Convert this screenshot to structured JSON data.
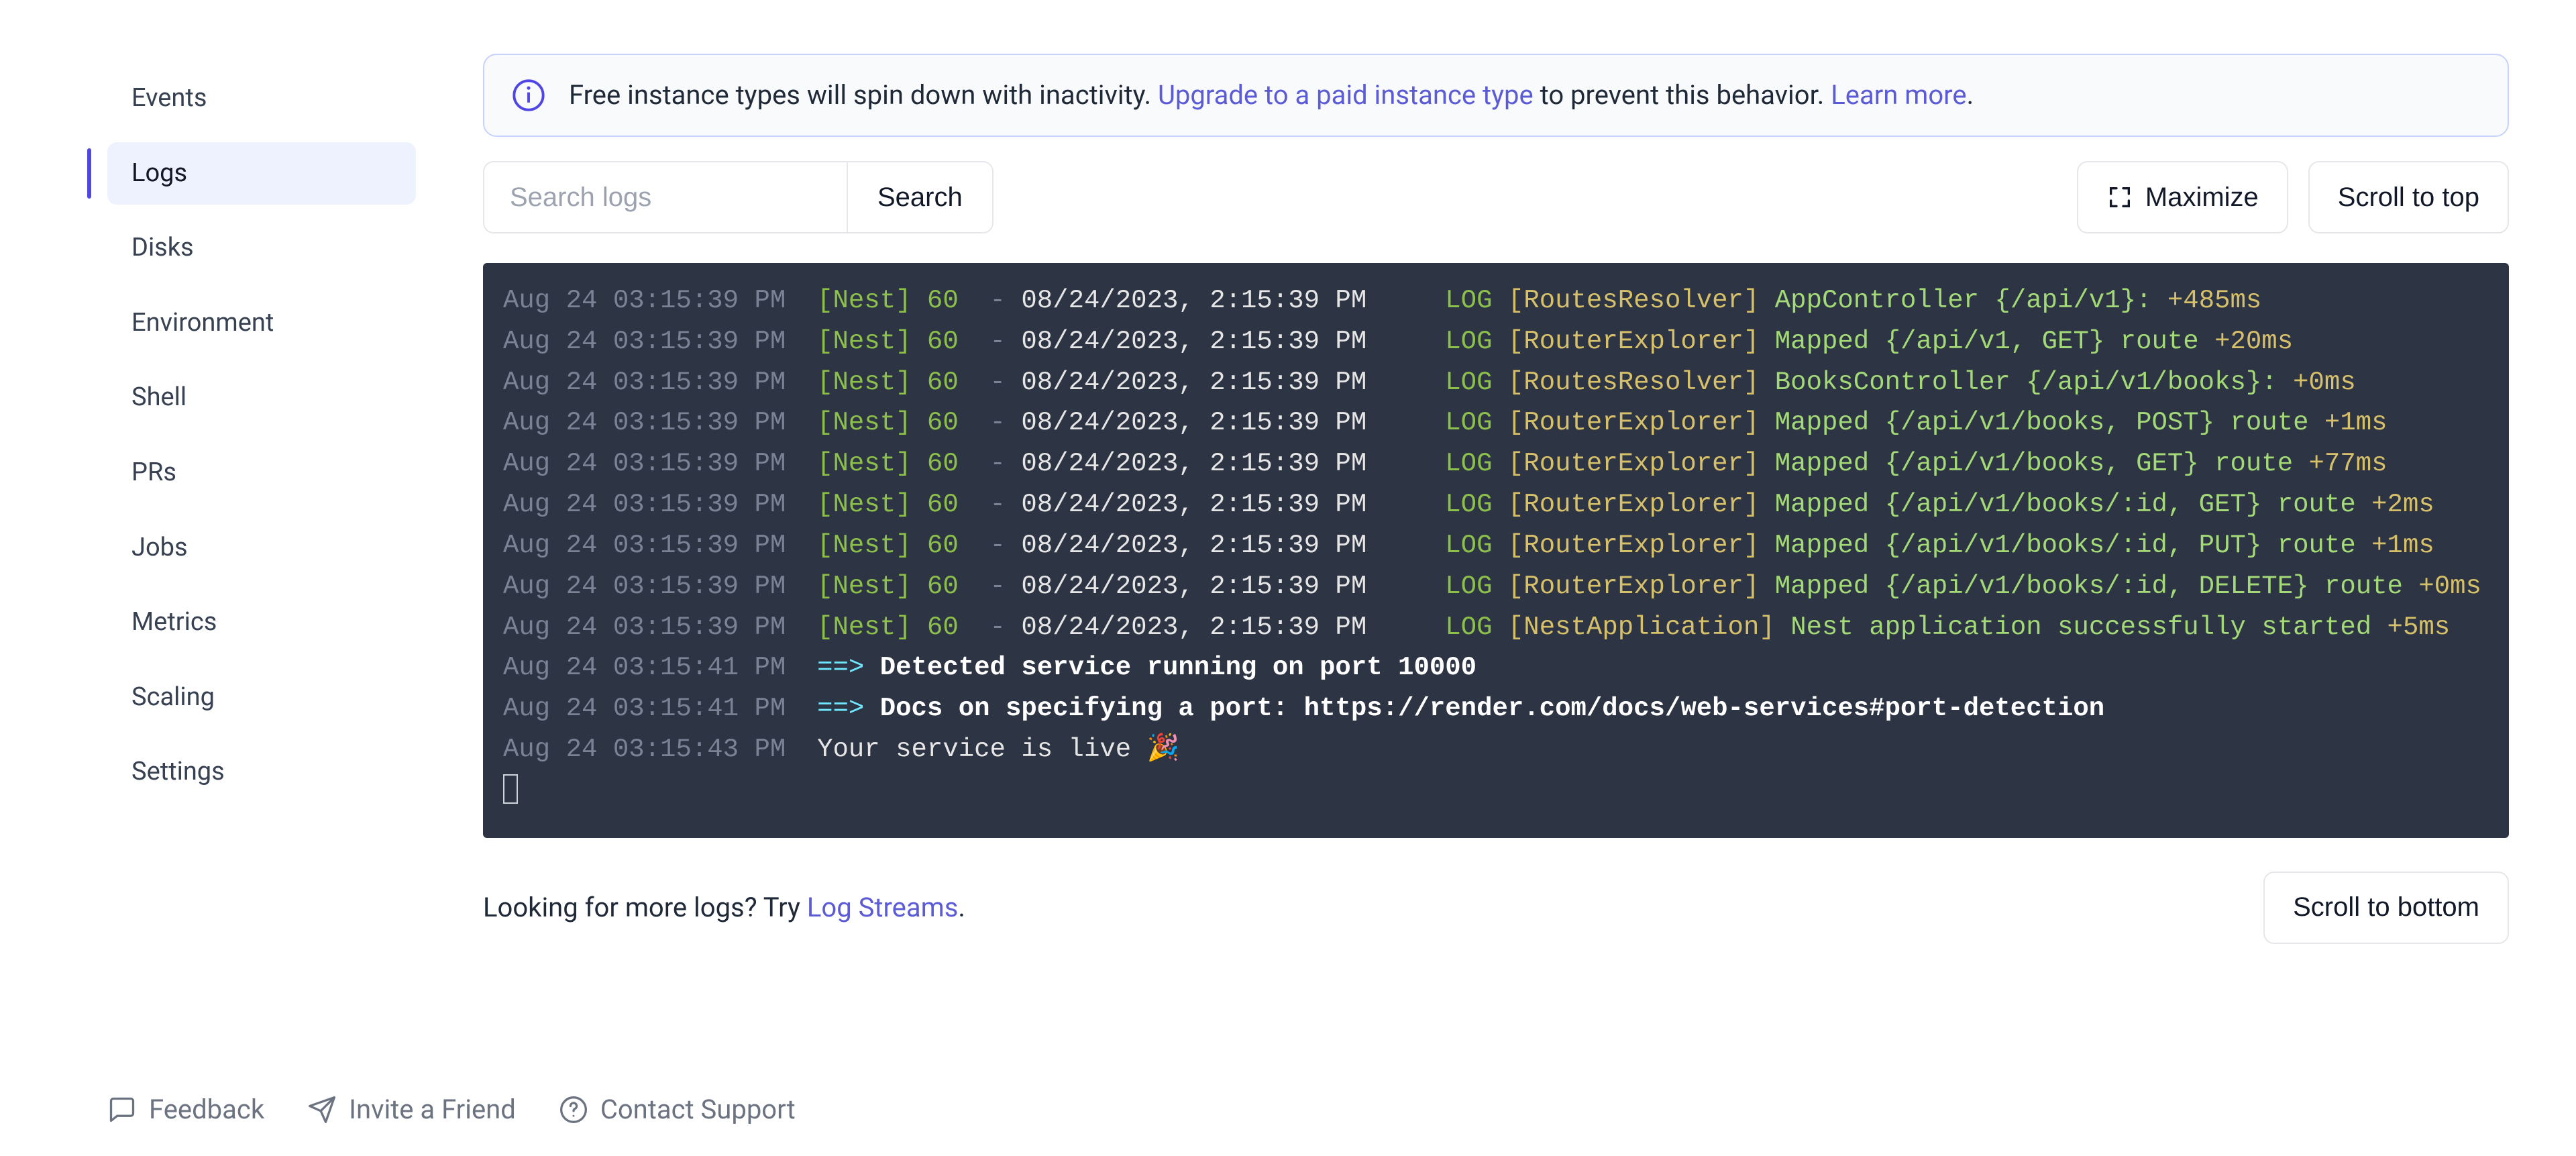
{
  "sidebar": {
    "items": [
      {
        "label": "Events"
      },
      {
        "label": "Logs"
      },
      {
        "label": "Disks"
      },
      {
        "label": "Environment"
      },
      {
        "label": "Shell"
      },
      {
        "label": "PRs"
      },
      {
        "label": "Jobs"
      },
      {
        "label": "Metrics"
      },
      {
        "label": "Scaling"
      },
      {
        "label": "Settings"
      }
    ],
    "activeIndex": 1
  },
  "banner": {
    "text_before": "Free instance types will spin down with inactivity. ",
    "link1": "Upgrade to a paid instance type",
    "text_mid": " to prevent this behavior. ",
    "link2": "Learn more",
    "text_after": "."
  },
  "search": {
    "placeholder": "Search logs",
    "value": "",
    "button": "Search"
  },
  "buttons": {
    "maximize": "Maximize",
    "scroll_top": "Scroll to top",
    "scroll_bottom": "Scroll to bottom"
  },
  "more": {
    "text_before": "Looking for more logs? Try ",
    "link": "Log Streams",
    "text_after": "."
  },
  "footer": {
    "feedback": "Feedback",
    "invite": "Invite a Friend",
    "support": "Contact Support"
  },
  "logs": [
    {
      "time": "Aug 24 03:15:39 PM",
      "nest": "[Nest] 60",
      "dash": "-",
      "ts": "08/24/2023, 2:15:39 PM",
      "lvl": "LOG",
      "ctx": "[RoutesResolver]",
      "msg": "AppController {/api/v1}:",
      "delta": "+485ms"
    },
    {
      "time": "Aug 24 03:15:39 PM",
      "nest": "[Nest] 60",
      "dash": "-",
      "ts": "08/24/2023, 2:15:39 PM",
      "lvl": "LOG",
      "ctx": "[RouterExplorer]",
      "msg": "Mapped {/api/v1, GET} route",
      "delta": "+20ms"
    },
    {
      "time": "Aug 24 03:15:39 PM",
      "nest": "[Nest] 60",
      "dash": "-",
      "ts": "08/24/2023, 2:15:39 PM",
      "lvl": "LOG",
      "ctx": "[RoutesResolver]",
      "msg": "BooksController {/api/v1/books}:",
      "delta": "+0ms"
    },
    {
      "time": "Aug 24 03:15:39 PM",
      "nest": "[Nest] 60",
      "dash": "-",
      "ts": "08/24/2023, 2:15:39 PM",
      "lvl": "LOG",
      "ctx": "[RouterExplorer]",
      "msg": "Mapped {/api/v1/books, POST} route",
      "delta": "+1ms"
    },
    {
      "time": "Aug 24 03:15:39 PM",
      "nest": "[Nest] 60",
      "dash": "-",
      "ts": "08/24/2023, 2:15:39 PM",
      "lvl": "LOG",
      "ctx": "[RouterExplorer]",
      "msg": "Mapped {/api/v1/books, GET} route",
      "delta": "+77ms"
    },
    {
      "time": "Aug 24 03:15:39 PM",
      "nest": "[Nest] 60",
      "dash": "-",
      "ts": "08/24/2023, 2:15:39 PM",
      "lvl": "LOG",
      "ctx": "[RouterExplorer]",
      "msg": "Mapped {/api/v1/books/:id, GET} route",
      "delta": "+2ms"
    },
    {
      "time": "Aug 24 03:15:39 PM",
      "nest": "[Nest] 60",
      "dash": "-",
      "ts": "08/24/2023, 2:15:39 PM",
      "lvl": "LOG",
      "ctx": "[RouterExplorer]",
      "msg": "Mapped {/api/v1/books/:id, PUT} route",
      "delta": "+1ms"
    },
    {
      "time": "Aug 24 03:15:39 PM",
      "nest": "[Nest] 60",
      "dash": "-",
      "ts": "08/24/2023, 2:15:39 PM",
      "lvl": "LOG",
      "ctx": "[RouterExplorer]",
      "msg": "Mapped {/api/v1/books/:id, DELETE} route",
      "delta": "+0ms"
    },
    {
      "time": "Aug 24 03:15:39 PM",
      "nest": "[Nest] 60",
      "dash": "-",
      "ts": "08/24/2023, 2:15:39 PM",
      "lvl": "LOG",
      "ctx": "[NestApplication]",
      "msg": "Nest application successfully started",
      "delta": "+5ms"
    }
  ],
  "logs_plain": [
    {
      "time": "Aug 24 03:15:41 PM",
      "arrow": "==>",
      "msg": "Detected service running on port 10000"
    },
    {
      "time": "Aug 24 03:15:41 PM",
      "arrow": "==>",
      "msg": "Docs on specifying a port: https://render.com/docs/web-services#port-detection"
    },
    {
      "time": "Aug 24 03:15:43 PM",
      "arrow": "",
      "msg": "Your service is live 🎉"
    }
  ]
}
